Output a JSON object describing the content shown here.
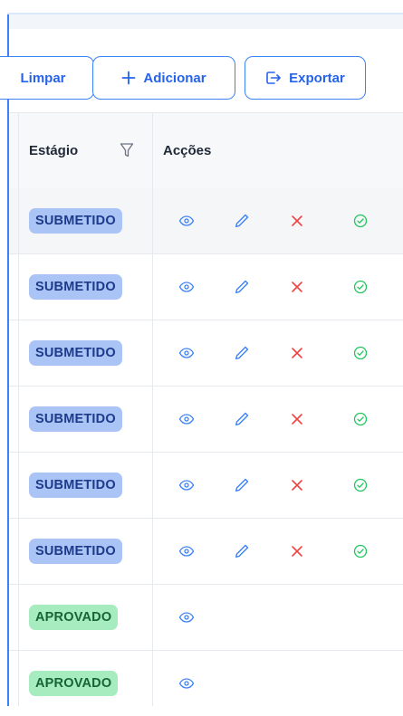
{
  "toolbar": {
    "clear_label": "Limpar",
    "add_label": "Adicionar",
    "export_label": "Exportar"
  },
  "table": {
    "columns": {
      "stage": "Estágio",
      "actions": "Acções"
    },
    "rows": [
      {
        "stage": "SUBMETIDO",
        "status": "submitted",
        "actions": [
          "view-icon",
          "edit-icon",
          "reject-icon",
          "approve-icon"
        ]
      },
      {
        "stage": "SUBMETIDO",
        "status": "submitted",
        "actions": [
          "view-icon",
          "edit-icon",
          "reject-icon",
          "approve-icon"
        ]
      },
      {
        "stage": "SUBMETIDO",
        "status": "submitted",
        "actions": [
          "view-icon",
          "edit-icon",
          "reject-icon",
          "approve-icon"
        ]
      },
      {
        "stage": "SUBMETIDO",
        "status": "submitted",
        "actions": [
          "view-icon",
          "edit-icon",
          "reject-icon",
          "approve-icon"
        ]
      },
      {
        "stage": "SUBMETIDO",
        "status": "submitted",
        "actions": [
          "view-icon",
          "edit-icon",
          "reject-icon",
          "approve-icon"
        ]
      },
      {
        "stage": "SUBMETIDO",
        "status": "submitted",
        "actions": [
          "view-icon",
          "edit-icon",
          "reject-icon",
          "approve-icon"
        ]
      },
      {
        "stage": "APROVADO",
        "status": "approved",
        "actions": [
          "view-icon"
        ]
      },
      {
        "stage": "APROVADO",
        "status": "approved",
        "actions": [
          "view-icon"
        ]
      }
    ]
  },
  "colors": {
    "accent": "#2563eb",
    "submitted_bg": "#aac4f6",
    "submitted_text": "#1e3a8a",
    "approved_bg": "#a7ecbf",
    "approved_text": "#166534",
    "reject": "#ef4444",
    "approve": "#22c55e"
  }
}
